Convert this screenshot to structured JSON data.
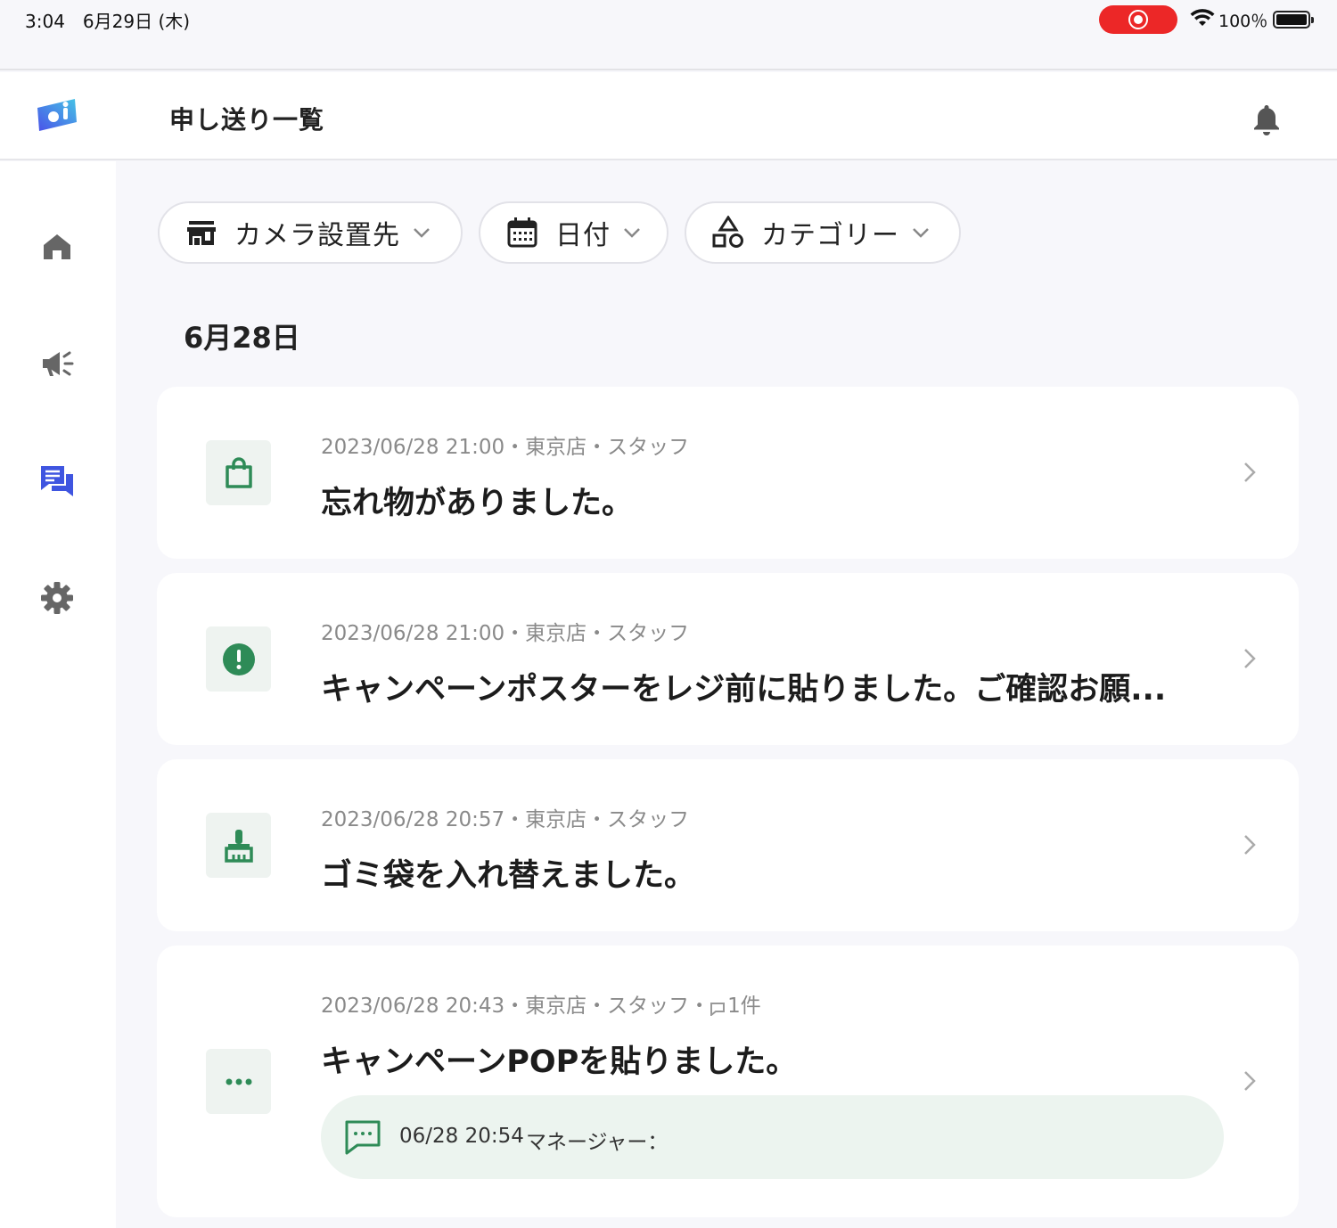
{
  "status_bar": {
    "time_date": "3:04　6月29日 (木)",
    "battery_percent": "100％"
  },
  "header": {
    "title": "申し送り一覧"
  },
  "sidebar": {
    "items": [
      {
        "icon": "home-icon",
        "active": false
      },
      {
        "icon": "megaphone-icon",
        "active": false
      },
      {
        "icon": "chat-icon",
        "active": true
      },
      {
        "icon": "gear-icon",
        "active": false
      }
    ]
  },
  "filters": {
    "camera": "カメラ設置先",
    "date": "日付",
    "category": "カテゴリー"
  },
  "date_heading": "6月28日",
  "items": [
    {
      "meta": "2023/06/28 21:00・東京店・スタッフ",
      "title": "忘れ物がありました。",
      "icon": "shopping-bag-icon"
    },
    {
      "meta": "2023/06/28 21:00・東京店・スタッフ",
      "title": "キャンペーンポスターをレジ前に貼りました。ご確認お願...",
      "icon": "alert-icon"
    },
    {
      "meta": "2023/06/28 20:57・東京店・スタッフ",
      "title": "ゴミ袋を入れ替えました。",
      "icon": "broom-icon"
    },
    {
      "meta_prefix": "2023/06/28 20:43・東京店・スタッフ・",
      "comment_count": "1件",
      "title": "キャンペーンPOPを貼りました。",
      "icon": "more-icon",
      "reply": {
        "time": "06/28 20:54",
        "author": "マネージャー："
      }
    }
  ],
  "colors": {
    "accent_green": "#2e8b57",
    "nav_active": "#3f55e0",
    "nav_inactive": "#666666",
    "record": "#ec2727"
  }
}
